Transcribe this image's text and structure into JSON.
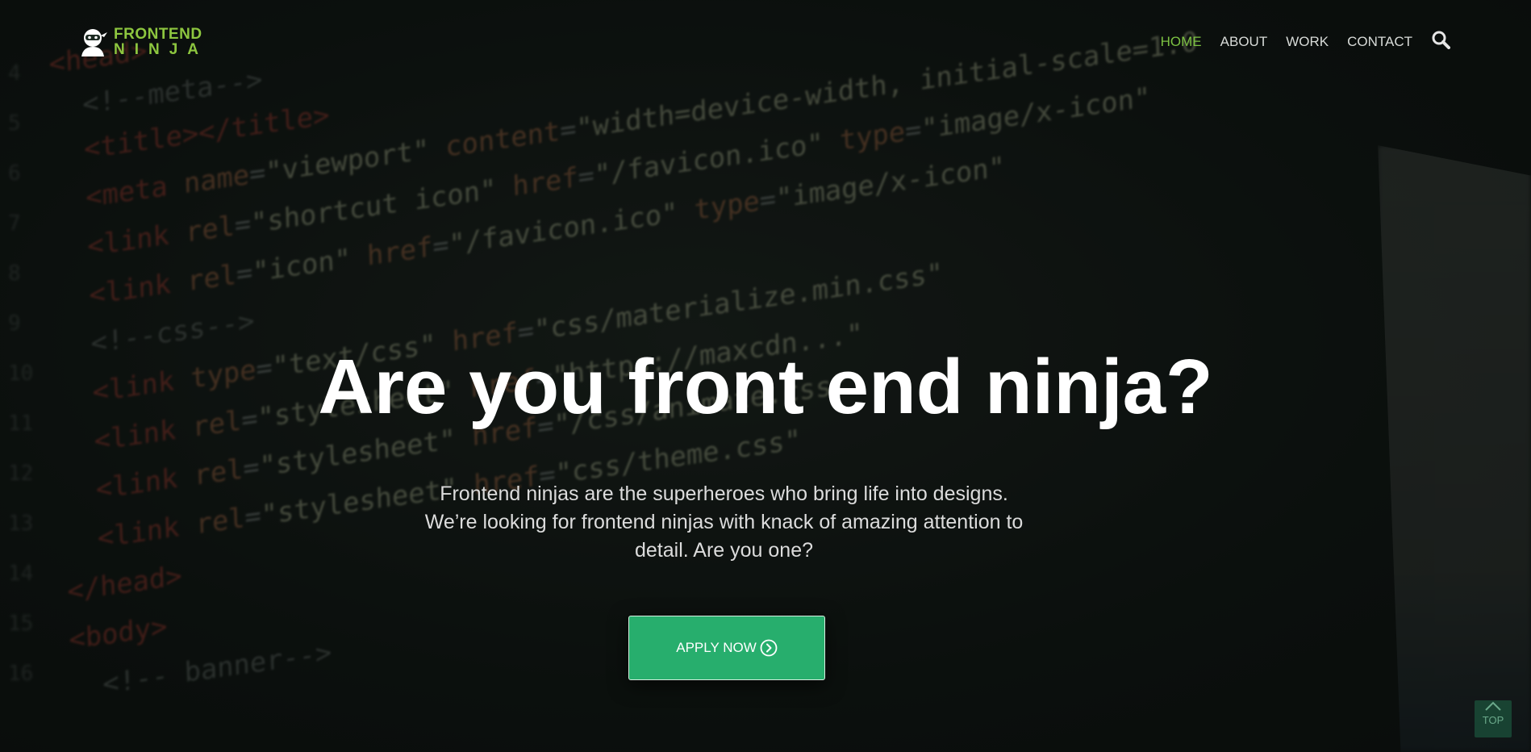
{
  "nav": {
    "logo": {
      "line1": "FRONTEND",
      "line2": "NINJA"
    },
    "items": [
      {
        "label": "HOME",
        "active": true
      },
      {
        "label": "ABOUT",
        "active": false
      },
      {
        "label": "WORK",
        "active": false
      },
      {
        "label": "CONTACT",
        "active": false
      }
    ],
    "search_icon": "search-icon"
  },
  "hero": {
    "title": "Are you front end ninja?",
    "description": "Frontend ninjas are the superheroes who bring life into designs. We’re looking for frontend ninjas with knack of amazing attention to detail. Are you one?",
    "cta_label": "APPLY NOW",
    "cta_icon": "chevron-right-circle-icon"
  },
  "back_to_top": {
    "label": "TOP",
    "icon": "chevron-up-icon"
  },
  "colors": {
    "accent": "#7cc242",
    "button": "#27ae6d",
    "background": "#0d130f"
  }
}
